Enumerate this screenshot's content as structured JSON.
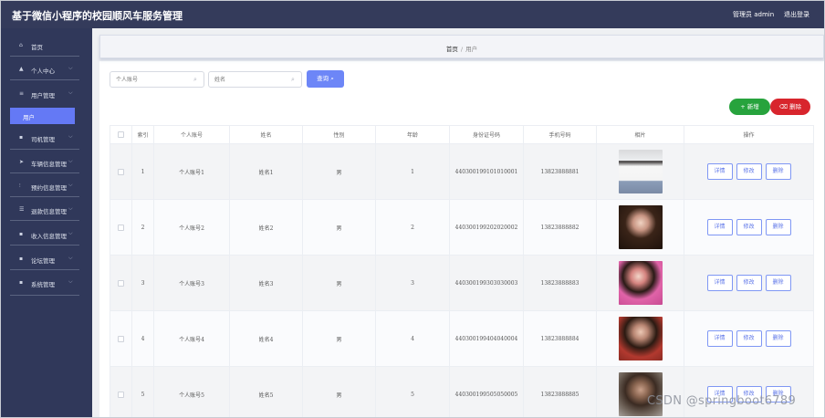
{
  "header": {
    "title": "基于微信小程序的校园顺风车服务管理",
    "user": "管理员 admin",
    "logout": "退出登录"
  },
  "sidebar": {
    "items": [
      {
        "label": "首页",
        "icon": "home-icon",
        "glyph": "⌂",
        "arrow": ""
      },
      {
        "label": "个人中心",
        "icon": "person-icon",
        "glyph": "▲",
        "arrow": "⌵"
      },
      {
        "label": "用户管理",
        "icon": "list-icon",
        "glyph": "≡",
        "arrow": "⌵"
      },
      {
        "label": "司机管理",
        "icon": "grid-icon",
        "glyph": "▪",
        "arrow": "⌵"
      },
      {
        "label": "车辆信息管理",
        "icon": "send-icon",
        "glyph": "➤",
        "arrow": "⌵"
      },
      {
        "label": "预约信息管理",
        "icon": "chart-icon",
        "glyph": "⫶",
        "arrow": "⌵"
      },
      {
        "label": "退款信息管理",
        "icon": "sliders-icon",
        "glyph": "☰",
        "arrow": "⌵"
      },
      {
        "label": "收入信息管理",
        "icon": "grid-icon",
        "glyph": "▪",
        "arrow": "⌵"
      },
      {
        "label": "论坛管理",
        "icon": "grid-icon",
        "glyph": "▪",
        "arrow": "⌵"
      },
      {
        "label": "系统管理",
        "icon": "grid-icon",
        "glyph": "▪",
        "arrow": "⌵"
      }
    ],
    "active_sub": "用户"
  },
  "breadcrumb": {
    "home": "首页",
    "sep": "/",
    "current": "用户"
  },
  "search": {
    "account_placeholder": "个人账号",
    "name_placeholder": "姓名",
    "button": "查询"
  },
  "actions": {
    "add": "新增",
    "delete": "删除"
  },
  "table": {
    "headers": [
      "索引",
      "个人账号",
      "姓名",
      "性别",
      "年龄",
      "身份证号码",
      "手机号码",
      "相片",
      "操作"
    ],
    "op_labels": {
      "detail": "详情",
      "edit": "修改",
      "delete": "删除"
    },
    "rows": [
      {
        "index": "1",
        "account": "个人账号1",
        "name": "姓名1",
        "gender": "男",
        "age": "1",
        "idcard": "440300199101010001",
        "phone": "13823888881"
      },
      {
        "index": "2",
        "account": "个人账号2",
        "name": "姓名2",
        "gender": "男",
        "age": "2",
        "idcard": "440300199202020002",
        "phone": "13823888882"
      },
      {
        "index": "3",
        "account": "个人账号3",
        "name": "姓名3",
        "gender": "男",
        "age": "3",
        "idcard": "440300199303030003",
        "phone": "13823888883"
      },
      {
        "index": "4",
        "account": "个人账号4",
        "name": "姓名4",
        "gender": "男",
        "age": "4",
        "idcard": "440300199404040004",
        "phone": "13823888884"
      },
      {
        "index": "5",
        "account": "个人账号5",
        "name": "姓名5",
        "gender": "男",
        "age": "5",
        "idcard": "440300199505050005",
        "phone": "13823888885"
      }
    ]
  },
  "watermark": "CSDN @springboot6789",
  "colors": {
    "topbar": "#343b5b",
    "sidebar": "#30385a",
    "accent": "#6d86f7",
    "add": "#27a33d",
    "delete": "#d8252d"
  }
}
